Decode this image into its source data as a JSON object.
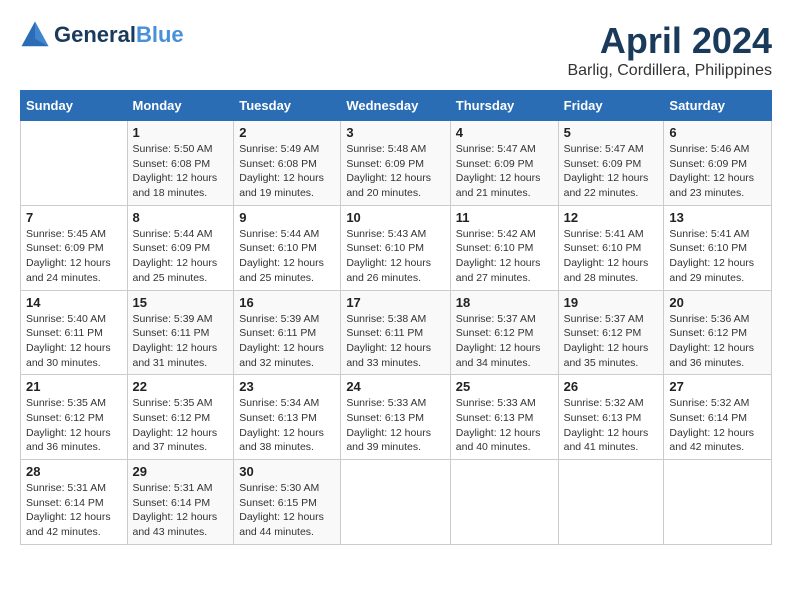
{
  "logo": {
    "line1": "General",
    "line2": "Blue"
  },
  "title": "April 2024",
  "subtitle": "Barlig, Cordillera, Philippines",
  "days_of_week": [
    "Sunday",
    "Monday",
    "Tuesday",
    "Wednesday",
    "Thursday",
    "Friday",
    "Saturday"
  ],
  "weeks": [
    [
      {
        "day": "",
        "info": ""
      },
      {
        "day": "1",
        "info": "Sunrise: 5:50 AM\nSunset: 6:08 PM\nDaylight: 12 hours\nand 18 minutes."
      },
      {
        "day": "2",
        "info": "Sunrise: 5:49 AM\nSunset: 6:08 PM\nDaylight: 12 hours\nand 19 minutes."
      },
      {
        "day": "3",
        "info": "Sunrise: 5:48 AM\nSunset: 6:09 PM\nDaylight: 12 hours\nand 20 minutes."
      },
      {
        "day": "4",
        "info": "Sunrise: 5:47 AM\nSunset: 6:09 PM\nDaylight: 12 hours\nand 21 minutes."
      },
      {
        "day": "5",
        "info": "Sunrise: 5:47 AM\nSunset: 6:09 PM\nDaylight: 12 hours\nand 22 minutes."
      },
      {
        "day": "6",
        "info": "Sunrise: 5:46 AM\nSunset: 6:09 PM\nDaylight: 12 hours\nand 23 minutes."
      }
    ],
    [
      {
        "day": "7",
        "info": "Sunrise: 5:45 AM\nSunset: 6:09 PM\nDaylight: 12 hours\nand 24 minutes."
      },
      {
        "day": "8",
        "info": "Sunrise: 5:44 AM\nSunset: 6:09 PM\nDaylight: 12 hours\nand 25 minutes."
      },
      {
        "day": "9",
        "info": "Sunrise: 5:44 AM\nSunset: 6:10 PM\nDaylight: 12 hours\nand 25 minutes."
      },
      {
        "day": "10",
        "info": "Sunrise: 5:43 AM\nSunset: 6:10 PM\nDaylight: 12 hours\nand 26 minutes."
      },
      {
        "day": "11",
        "info": "Sunrise: 5:42 AM\nSunset: 6:10 PM\nDaylight: 12 hours\nand 27 minutes."
      },
      {
        "day": "12",
        "info": "Sunrise: 5:41 AM\nSunset: 6:10 PM\nDaylight: 12 hours\nand 28 minutes."
      },
      {
        "day": "13",
        "info": "Sunrise: 5:41 AM\nSunset: 6:10 PM\nDaylight: 12 hours\nand 29 minutes."
      }
    ],
    [
      {
        "day": "14",
        "info": "Sunrise: 5:40 AM\nSunset: 6:11 PM\nDaylight: 12 hours\nand 30 minutes."
      },
      {
        "day": "15",
        "info": "Sunrise: 5:39 AM\nSunset: 6:11 PM\nDaylight: 12 hours\nand 31 minutes."
      },
      {
        "day": "16",
        "info": "Sunrise: 5:39 AM\nSunset: 6:11 PM\nDaylight: 12 hours\nand 32 minutes."
      },
      {
        "day": "17",
        "info": "Sunrise: 5:38 AM\nSunset: 6:11 PM\nDaylight: 12 hours\nand 33 minutes."
      },
      {
        "day": "18",
        "info": "Sunrise: 5:37 AM\nSunset: 6:12 PM\nDaylight: 12 hours\nand 34 minutes."
      },
      {
        "day": "19",
        "info": "Sunrise: 5:37 AM\nSunset: 6:12 PM\nDaylight: 12 hours\nand 35 minutes."
      },
      {
        "day": "20",
        "info": "Sunrise: 5:36 AM\nSunset: 6:12 PM\nDaylight: 12 hours\nand 36 minutes."
      }
    ],
    [
      {
        "day": "21",
        "info": "Sunrise: 5:35 AM\nSunset: 6:12 PM\nDaylight: 12 hours\nand 36 minutes."
      },
      {
        "day": "22",
        "info": "Sunrise: 5:35 AM\nSunset: 6:12 PM\nDaylight: 12 hours\nand 37 minutes."
      },
      {
        "day": "23",
        "info": "Sunrise: 5:34 AM\nSunset: 6:13 PM\nDaylight: 12 hours\nand 38 minutes."
      },
      {
        "day": "24",
        "info": "Sunrise: 5:33 AM\nSunset: 6:13 PM\nDaylight: 12 hours\nand 39 minutes."
      },
      {
        "day": "25",
        "info": "Sunrise: 5:33 AM\nSunset: 6:13 PM\nDaylight: 12 hours\nand 40 minutes."
      },
      {
        "day": "26",
        "info": "Sunrise: 5:32 AM\nSunset: 6:13 PM\nDaylight: 12 hours\nand 41 minutes."
      },
      {
        "day": "27",
        "info": "Sunrise: 5:32 AM\nSunset: 6:14 PM\nDaylight: 12 hours\nand 42 minutes."
      }
    ],
    [
      {
        "day": "28",
        "info": "Sunrise: 5:31 AM\nSunset: 6:14 PM\nDaylight: 12 hours\nand 42 minutes."
      },
      {
        "day": "29",
        "info": "Sunrise: 5:31 AM\nSunset: 6:14 PM\nDaylight: 12 hours\nand 43 minutes."
      },
      {
        "day": "30",
        "info": "Sunrise: 5:30 AM\nSunset: 6:15 PM\nDaylight: 12 hours\nand 44 minutes."
      },
      {
        "day": "",
        "info": ""
      },
      {
        "day": "",
        "info": ""
      },
      {
        "day": "",
        "info": ""
      },
      {
        "day": "",
        "info": ""
      }
    ]
  ]
}
